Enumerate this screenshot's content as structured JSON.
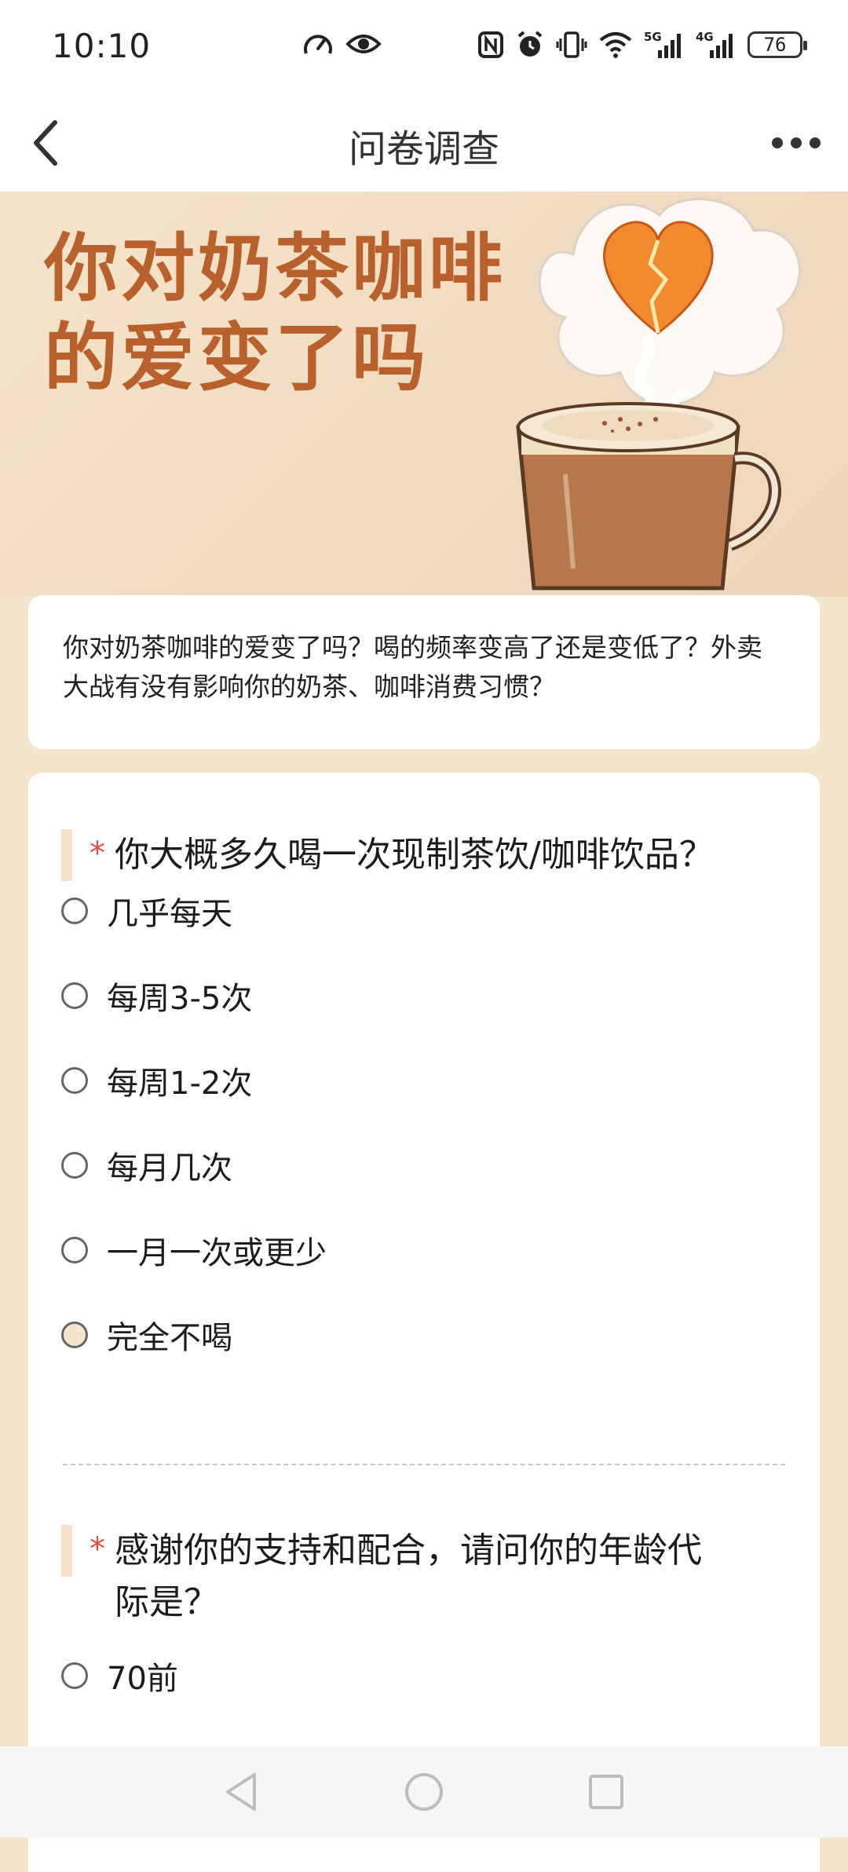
{
  "status_bar": {
    "time": "10:10",
    "battery": "76",
    "network_labels": [
      "5G",
      "4G"
    ],
    "icons_left": [
      "speedometer-icon",
      "eye-icon"
    ],
    "icons_right": [
      "nfc-icon",
      "alarm-icon",
      "vibrate-icon",
      "wifi-icon",
      "signal-5g-icon",
      "signal-4g-icon",
      "battery-icon"
    ]
  },
  "header": {
    "title": "问卷调查",
    "back_icon": "chevron-left-icon",
    "more_icon": "more-horizontal-icon"
  },
  "banner": {
    "title_line1": "你对奶茶咖啡",
    "title_line2": "的爱变了吗",
    "colors": {
      "title": "#b8612c",
      "background": "#f3e2cb",
      "heart": "#f08a2c"
    }
  },
  "intro": {
    "text": "你对奶茶咖啡的爱变了吗？喝的频率变高了还是变低了？外卖大战有没有影响你的奶茶、咖啡消费习惯？"
  },
  "questions": [
    {
      "required_mark": "*",
      "title": "你大概多久喝一次现制茶饮/咖啡饮品？",
      "options": [
        "几乎每天",
        "每周3-5次",
        "每周1-2次",
        "每月几次",
        "一月一次或更少",
        "完全不喝"
      ],
      "highlighted_option": "完全不喝"
    },
    {
      "required_mark": "*",
      "title_line1": "感谢你的支持和配合，请问你的年龄代",
      "title_line2": "际是？",
      "options": [
        "70前"
      ]
    }
  ],
  "nav_bar": {
    "icons": [
      "back-triangle-icon",
      "home-circle-icon",
      "recents-square-icon"
    ]
  },
  "colors": {
    "page_background": "#f3e6cc",
    "required_star": "#e34b3d",
    "question_bar": "#f5e2c8"
  }
}
